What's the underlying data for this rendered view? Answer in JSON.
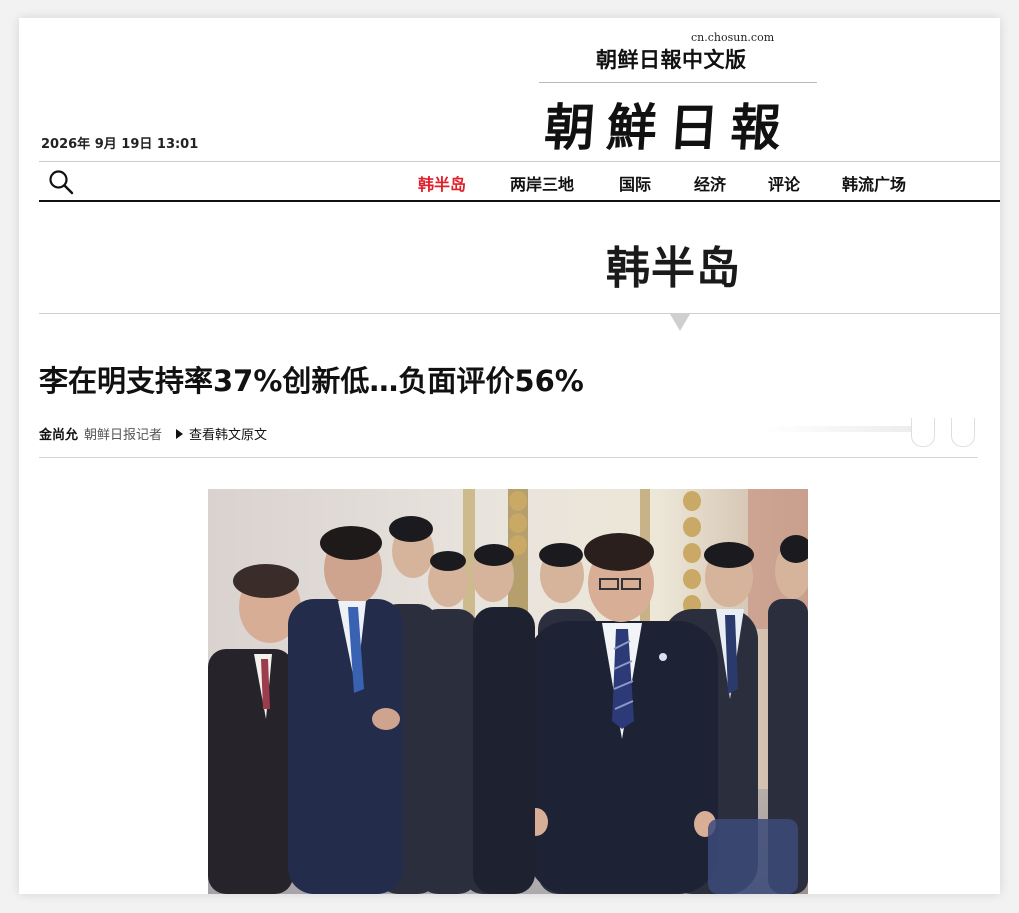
{
  "masthead": {
    "url": "cn.chosun.com",
    "site_title": "朝鲜日報中文版",
    "logo": "朝鮮日報"
  },
  "datetime": "2026年 9月 19日 13:01",
  "nav": {
    "search_icon": "search-icon",
    "items": [
      {
        "label": "韩半岛",
        "active": true
      },
      {
        "label": "两岸三地",
        "active": false
      },
      {
        "label": "国际",
        "active": false
      },
      {
        "label": "经济",
        "active": false
      },
      {
        "label": "评论",
        "active": false
      },
      {
        "label": "韩流广场",
        "active": false
      }
    ]
  },
  "section": {
    "title": "韩半岛"
  },
  "article": {
    "headline": "李在明支持率37%创新低…负面评价56%",
    "author": "金尚允",
    "author_role": "朝鲜日报记者",
    "original_link": "查看韩文原文"
  },
  "colors": {
    "accent": "#e0202a",
    "text": "#111111",
    "rule": "#cfcfcf"
  }
}
